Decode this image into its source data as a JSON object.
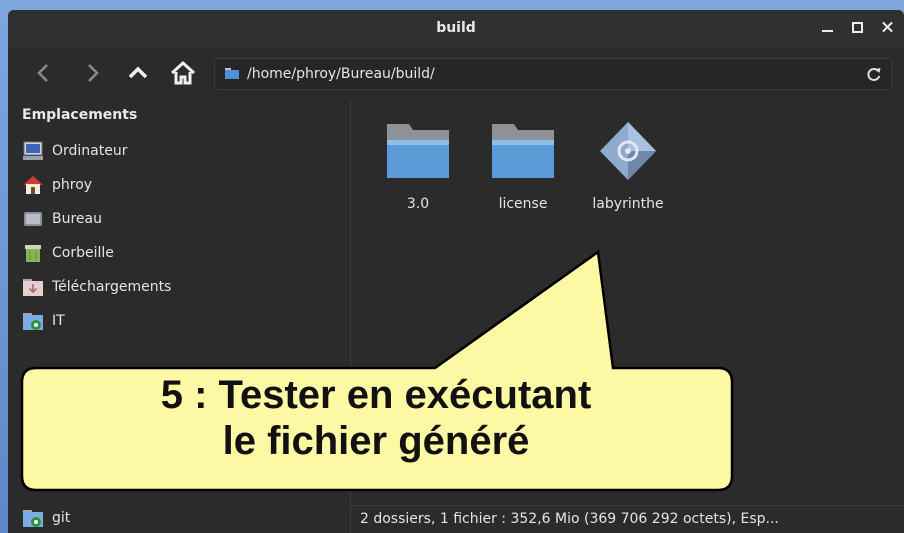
{
  "window": {
    "title": "build",
    "buttons": {
      "minimize": "minimize",
      "maximize": "maximize",
      "close": "close"
    }
  },
  "toolbar": {
    "back_icon": "chevron-left-icon",
    "forward_icon": "chevron-right-icon",
    "up_icon": "chevron-up-icon",
    "home_icon": "home-icon",
    "path": "/home/phroy/Bureau/build/",
    "reload_icon": "reload-icon"
  },
  "sidebar": {
    "heading": "Emplacements",
    "items": [
      {
        "label": "Ordinateur",
        "icon": "computer-icon"
      },
      {
        "label": "phroy",
        "icon": "home-folder-icon"
      },
      {
        "label": "Bureau",
        "icon": "desktop-icon"
      },
      {
        "label": "Corbeille",
        "icon": "trash-icon"
      },
      {
        "label": "Téléchargements",
        "icon": "downloads-folder-icon"
      },
      {
        "label": "IT",
        "icon": "folder-link-icon"
      },
      {
        "label": "git",
        "icon": "folder-link-icon"
      }
    ]
  },
  "files": [
    {
      "name": "3.0",
      "icon": "folder-icon"
    },
    {
      "name": "license",
      "icon": "folder-icon"
    },
    {
      "name": "labyrinthe",
      "icon": "executable-icon"
    }
  ],
  "status": {
    "text": "2 dossiers, 1 fichier  : 352,6  Mio (369 706 292 octets), Esp..."
  },
  "callout": {
    "line1": "5 : Tester en exécutant",
    "line2": "le fichier généré"
  },
  "colors": {
    "window_bg": "#2b2b2b",
    "callout_fill": "#fdf8a4",
    "folder_blue": "#5b9bd8",
    "desktop_bg": "#6e96d3"
  }
}
